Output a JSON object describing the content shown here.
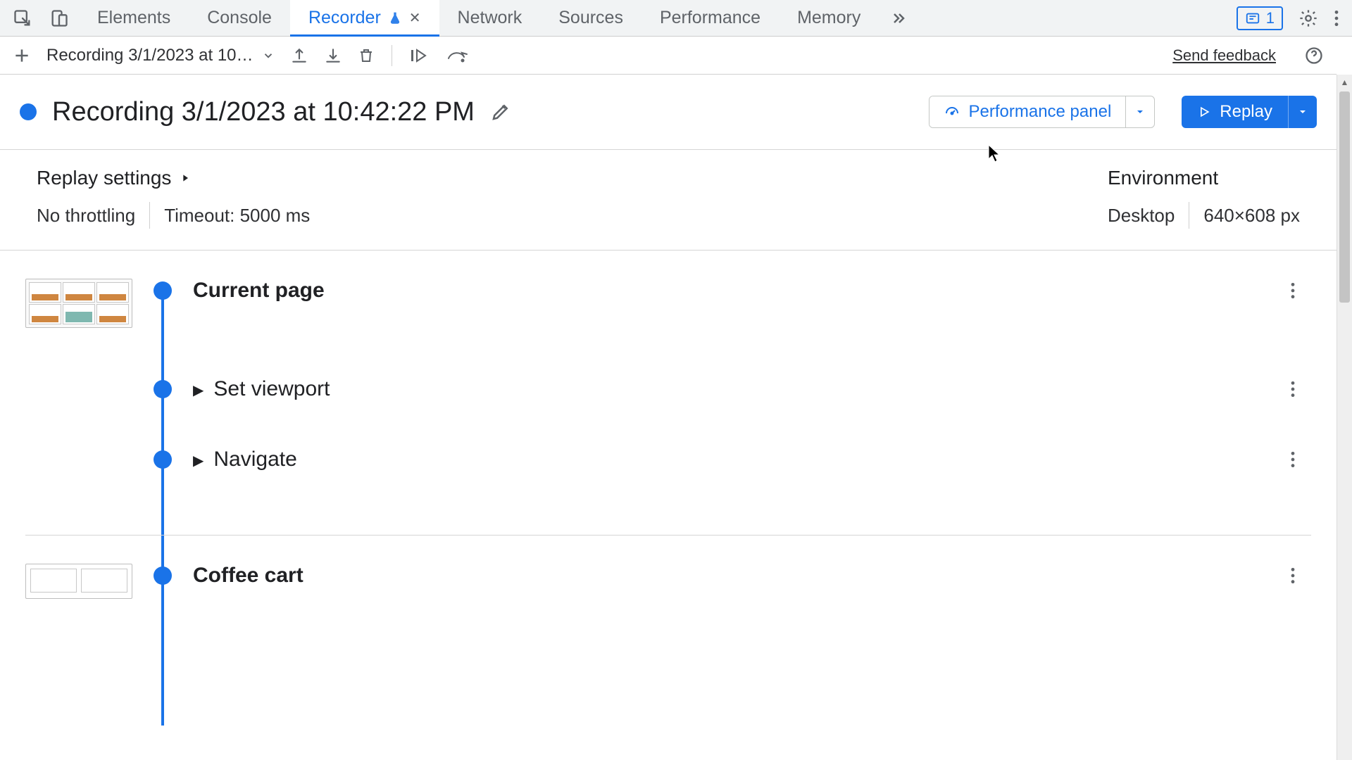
{
  "tabs": {
    "elements": "Elements",
    "console": "Console",
    "recorder": "Recorder",
    "network": "Network",
    "sources": "Sources",
    "performance": "Performance",
    "memory": "Memory"
  },
  "issues_count": "1",
  "toolbar": {
    "recording_select": "Recording 3/1/2023 at 10…",
    "send_feedback": "Send feedback"
  },
  "title": {
    "text": "Recording 3/1/2023 at 10:42:22 PM",
    "perf_panel": "Performance panel",
    "replay": "Replay"
  },
  "settings": {
    "heading": "Replay settings",
    "throttling": "No throttling",
    "timeout": "Timeout: 5000 ms"
  },
  "environment": {
    "heading": "Environment",
    "device": "Desktop",
    "viewport": "640×608 px"
  },
  "steps": {
    "current_page": "Current page",
    "set_viewport": "Set viewport",
    "navigate": "Navigate",
    "coffee_cart": "Coffee cart"
  }
}
